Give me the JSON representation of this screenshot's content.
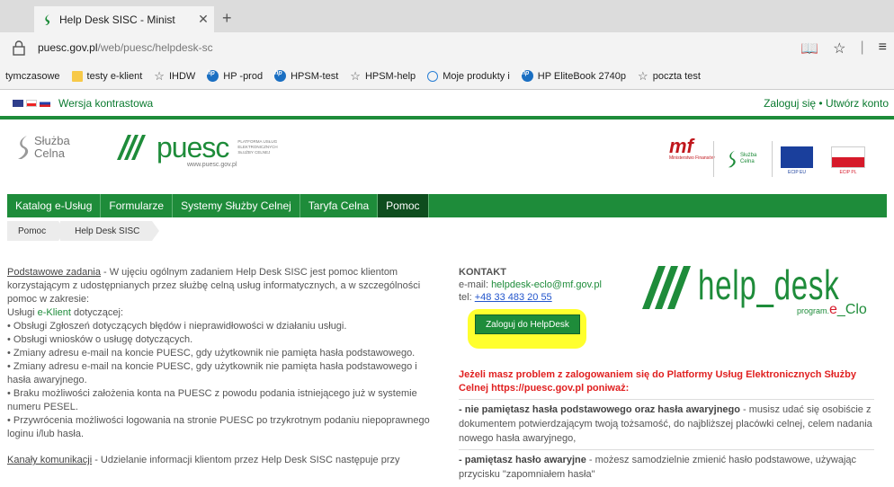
{
  "browser": {
    "tab_title": "Help Desk SISC - Minist",
    "tab_close": "✕",
    "new_tab": "+",
    "url_host": "puesc.gov.pl",
    "url_path": "/web/puesc/helpdesk-sc",
    "reading_icon": "book-icon",
    "favorite_icon": "star-icon"
  },
  "favorites": [
    {
      "label": "tymczasowe",
      "icon": "none"
    },
    {
      "label": "testy e-klient",
      "icon": "folder-icon"
    },
    {
      "label": "IHDW",
      "icon": "star-icon"
    },
    {
      "label": "HP -prod",
      "icon": "hp-icon"
    },
    {
      "label": "HPSM-test",
      "icon": "hp-icon"
    },
    {
      "label": "HPSM-help",
      "icon": "star-icon"
    },
    {
      "label": "Moje produkty i",
      "icon": "globe-icon"
    },
    {
      "label": "HP EliteBook 2740p",
      "icon": "hp-icon"
    },
    {
      "label": "poczta test",
      "icon": "star-icon"
    }
  ],
  "site": {
    "contrast": "Wersja kontrastowa",
    "login_links": "Zaloguj się • Utwórz konto",
    "sc_logo_line1": "Służba",
    "sc_logo_line2": "Celna",
    "puesc_word": "puesc",
    "puesc_url": "www.puesc.gov.pl",
    "puesc_small": "PLATFORMA USŁUG ELEKTRONICZNYCH SŁUŻBY CELNEJ",
    "mf_mark": "mf",
    "mf_text": "Ministerstwo Finansów",
    "sc2_line1": "Służba",
    "sc2_line2": "Celna",
    "eu_label": "ECIP EU",
    "pl_label": "ECIP PL"
  },
  "nav": [
    "Katalog e-Usług",
    "Formularze",
    "Systemy Służby Celnej",
    "Taryfa Celna",
    "Pomoc"
  ],
  "breadcrumbs": [
    "Pomoc",
    "Help Desk SISC"
  ],
  "left": {
    "p1_title": "Podstawowe zadania",
    "p1_text": " - W ujęciu ogólnym zadaniem Help Desk SISC jest pomoc klientom korzystającym z udostępnianych przez służbę celną usług informatycznych, a w szczególności pomoc w zakresie:",
    "services_pre": "Usługi ",
    "services_link": "e-Klient",
    "services_post": " dotyczącej:",
    "bullets": [
      "• Obsługi Zgłoszeń dotyczących błędów i nieprawidłowości w działaniu usługi.",
      "• Obsługi wniosków o usługę dotyczących.",
      "• Zmiany adresu e-mail na koncie PUESC, gdy użytkownik nie pamięta hasła podstawowego.",
      "• Zmiany adresu e-mail na koncie PUESC, gdy użytkownik nie pamięta hasła podstawowego i hasła awaryjnego.",
      "• Braku możliwości założenia konta na PUESC z powodu podania istniejącego już w systemie numeru PESEL.",
      "• Przywrócenia możliwości logowania na stronie PUESC po trzykrotnym podaniu niepoprawnego loginu i/lub hasła."
    ],
    "p2_title": "Kanały komunikacji",
    "p2_text": " - Udzielanie informacji klientom przez Help Desk SISC następuje przy"
  },
  "contact": {
    "heading": "KONTAKT",
    "email_label": "e-mail: ",
    "email": "helpdesk-eclo@mf.gov.pl",
    "tel_label": "tel: ",
    "tel": "+48 33 483 20 55",
    "login_button": "Zaloguj do HelpDesk"
  },
  "helpdesk_logo": {
    "word": "help_desk",
    "prog": "program.",
    "e": "e",
    "clo": "_Clo"
  },
  "warning": "Jeżeli masz problem z zalogowaniem się do Platformy Usług Elektronicznych Służby Celnej https://puesc.gov.pl poniważ:",
  "info1_bold": "- nie pamiętasz hasła podstawowego oraz hasła awaryjnego",
  "info1_text": " - musisz udać się osobiście z dokumentem potwierdzającym twoją tożsamość, do najbliższej placówki celnej, celem nadania nowego hasła awaryjnego,",
  "info2_bold": "- pamiętasz hasło awaryjne",
  "info2_text": " - możesz samodzielnie zmienić hasło podstawowe, używając przycisku \"zapomniałem hasła\"",
  "colors": {
    "green": "#1e8c3a",
    "dark_green": "#0e4d1e",
    "red": "#e02020",
    "highlight": "#ffff2e"
  }
}
